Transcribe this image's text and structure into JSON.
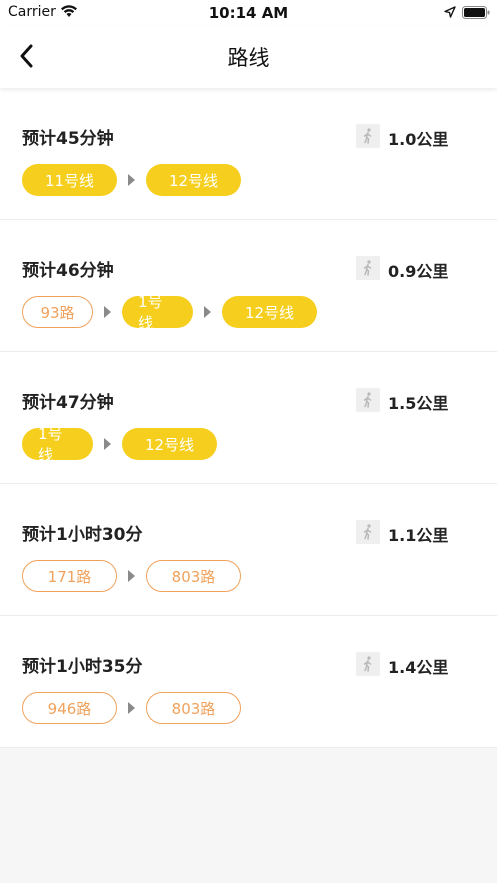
{
  "status_bar": {
    "carrier": "Carrier",
    "time": "10:14 AM"
  },
  "nav": {
    "title": "路线"
  },
  "colors": {
    "metro": "#f6cf1e",
    "bus": "#f0a25c"
  },
  "routes": [
    {
      "time": "预计45分钟",
      "distance": "1.0公里",
      "segments": [
        "11号线",
        "12号线"
      ]
    },
    {
      "time": "预计46分钟",
      "distance": "0.9公里",
      "segments": [
        "93路",
        "1号线",
        "12号线"
      ]
    },
    {
      "time": "预计47分钟",
      "distance": "1.5公里",
      "segments": [
        "1号线",
        "12号线"
      ]
    },
    {
      "time": "预计1小时30分",
      "distance": "1.1公里",
      "segments": [
        "171路",
        "803路"
      ]
    },
    {
      "time": "预计1小时35分",
      "distance": "1.4公里",
      "segments": [
        "946路",
        "803路"
      ]
    }
  ]
}
